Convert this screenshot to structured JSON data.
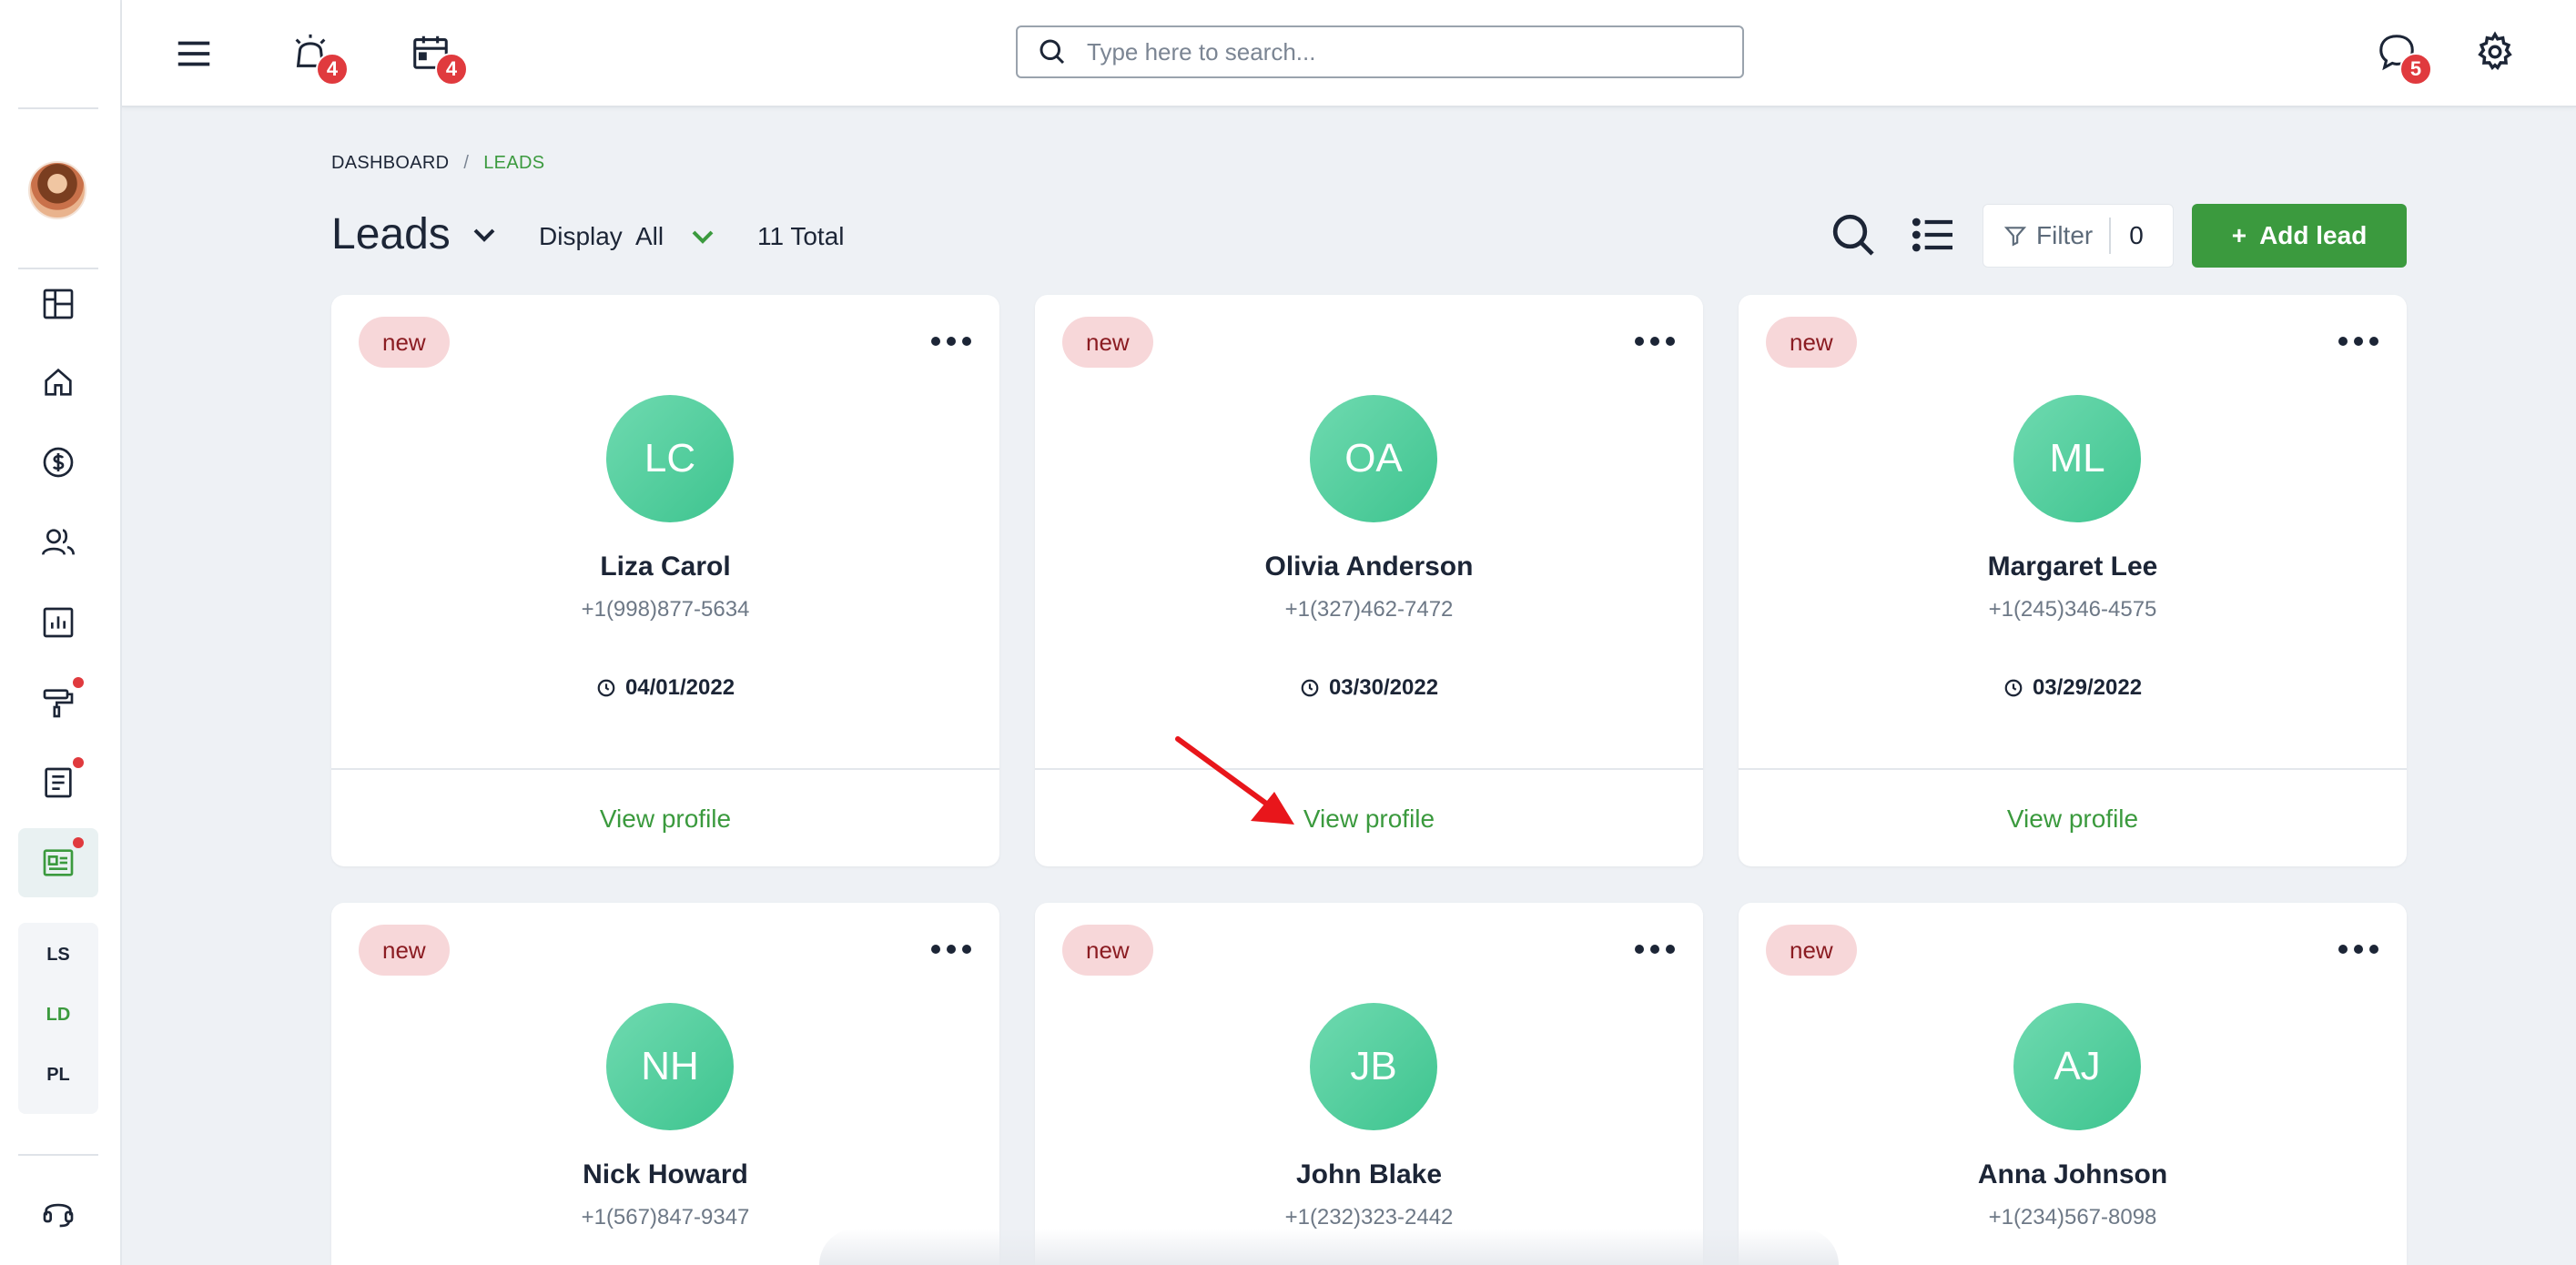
{
  "topbar": {
    "alarm_badge": "4",
    "calendar_badge": "4",
    "chat_badge": "5",
    "search_placeholder": "Type here to search..."
  },
  "sidebar": {
    "sub_items": [
      "LS",
      "LD",
      "PL"
    ],
    "active_sub": "LD"
  },
  "breadcrumb": {
    "home": "DASHBOARD",
    "separator": "/",
    "current": "LEADS"
  },
  "header": {
    "title": "Leads",
    "display_label": "Display",
    "display_value": "All",
    "total": "11 Total",
    "filter_label": "Filter",
    "filter_count": "0",
    "add_label": "Add lead",
    "add_icon": "+"
  },
  "colors": {
    "accent": "#3b9a3e",
    "badge": "#e03a3e",
    "tag_bg": "#f7d7d9",
    "avatar_green": "#4fcf9c"
  },
  "cards": [
    {
      "tag": "new",
      "initials": "LC",
      "name": "Liza Carol",
      "phone": "+1(998)877-5634",
      "date": "04/01/2022",
      "link": "View profile"
    },
    {
      "tag": "new",
      "initials": "OA",
      "name": "Olivia Anderson",
      "phone": "+1(327)462-7472",
      "date": "03/30/2022",
      "link": "View profile"
    },
    {
      "tag": "new",
      "initials": "ML",
      "name": "Margaret Lee",
      "phone": "+1(245)346-4575",
      "date": "03/29/2022",
      "link": "View profile"
    },
    {
      "tag": "new",
      "initials": "NH",
      "name": "Nick Howard",
      "phone": "+1(567)847-9347"
    },
    {
      "tag": "new",
      "initials": "JB",
      "name": "John Blake",
      "phone": "+1(232)323-2442"
    },
    {
      "tag": "new",
      "initials": "AJ",
      "name": "Anna Johnson",
      "phone": "+1(234)567-8098"
    }
  ]
}
